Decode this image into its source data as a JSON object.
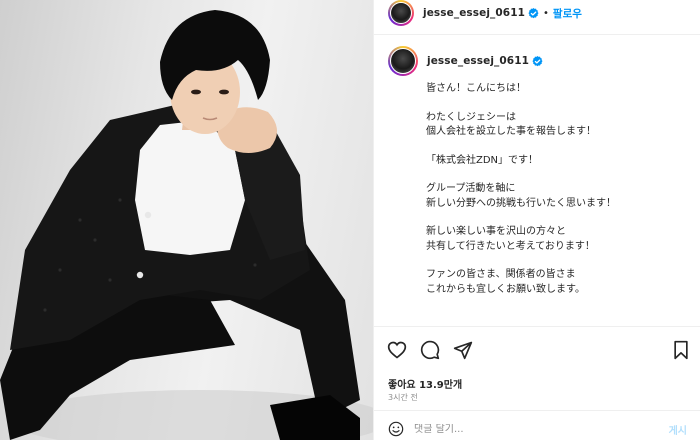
{
  "post": {
    "username": "jesse_essej_0611",
    "follow_label": "팔로우",
    "separator": "•",
    "caption_lines": [
      "皆さん！こんにちは！",
      "",
      "わたくしジェシーは",
      "個人会社を設立した事を報告します！",
      "",
      "「株式会社ZDN」です！",
      "",
      "グループ活動を軸に",
      "新しい分野への挑戦も行いたく思います！",
      "",
      "新しい楽しい事を沢山の方々と",
      "共有して行きたいと考えております！",
      "",
      "ファンの皆さま、関係者の皆さま",
      "これからも宜しくお願い致します。"
    ],
    "likes": "좋아요 13.9만개",
    "time": "3시간 전",
    "comment_placeholder": "댓글 달기...",
    "post_label": "게시"
  },
  "icons": {
    "header_avatar": "profile-avatar-icon",
    "verified": "verified-badge-icon",
    "like": "heart-icon",
    "comment": "comment-bubble-icon",
    "share": "paper-plane-icon",
    "save": "bookmark-icon",
    "emoji": "smiley-icon"
  },
  "colors": {
    "accent_blue": "#0095f6",
    "text": "#262626",
    "muted": "#8e8e8e",
    "post_button_disabled": "#b2dffc"
  }
}
